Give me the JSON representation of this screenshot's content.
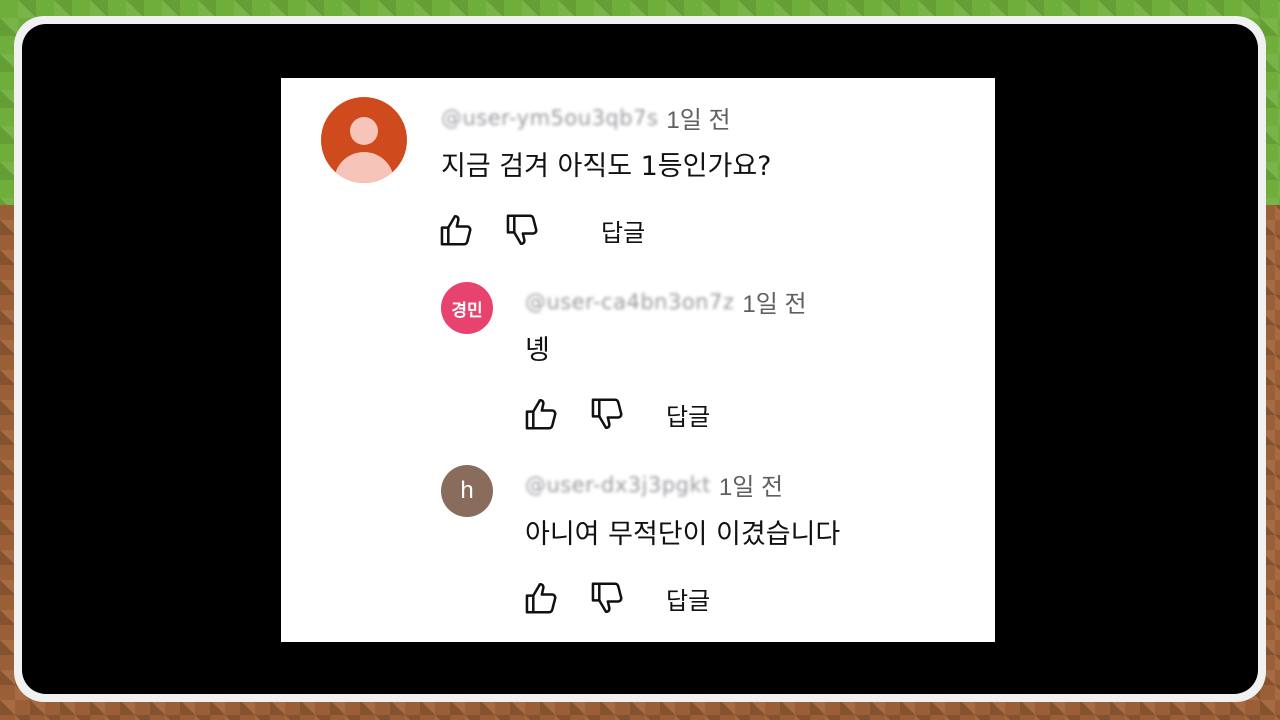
{
  "comments": [
    {
      "avatar_letter": "",
      "avatar_color": "#cf4a1c",
      "handle": "@user-ym5ou3qb7s",
      "time": "1일 전",
      "text": "지금 검겨 아직도 1등인가요?",
      "reply_label": "답글"
    },
    {
      "avatar_letter": "경민",
      "avatar_color": "#e8436f",
      "handle": "@user-ca4bn3on7z",
      "time": "1일 전",
      "text": "녱",
      "reply_label": "답글"
    },
    {
      "avatar_letter": "h",
      "avatar_color": "#8a6c5d",
      "handle": "@user-dx3j3pgkt",
      "time": "1일 전",
      "text": "아니여 무적단이 이겼습니다",
      "reply_label": "답글"
    }
  ],
  "icons": {
    "like": "thumbs-up-icon",
    "dislike": "thumbs-down-icon"
  }
}
